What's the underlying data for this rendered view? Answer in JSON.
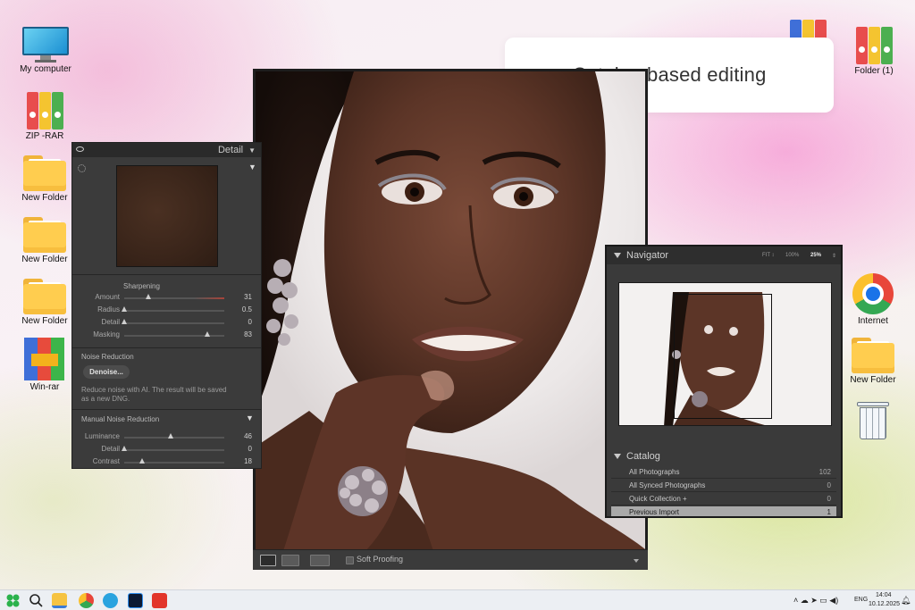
{
  "desktop": {
    "left_icons": [
      {
        "label": "My computer"
      },
      {
        "label": "ZIP -RAR"
      },
      {
        "label": "New Folder"
      },
      {
        "label": "New Folder"
      },
      {
        "label": "New Folder"
      },
      {
        "label": "Win-rar"
      }
    ],
    "right_icons": [
      {
        "label": "Folder (1)"
      },
      {
        "label": "Internet"
      },
      {
        "label": "New Folder"
      }
    ]
  },
  "caption": {
    "text": "Catalog based editing"
  },
  "detail_panel": {
    "title": "Detail",
    "sharpening": {
      "title": "Sharpening",
      "sliders": [
        {
          "label": "Amount",
          "value": "31",
          "level": 0.24
        },
        {
          "label": "Radius",
          "value": "0.5",
          "level": 0.0
        },
        {
          "label": "Detail",
          "value": "0",
          "level": 0.0
        },
        {
          "label": "Masking",
          "value": "83",
          "level": 0.83
        }
      ]
    },
    "noise_reduction": {
      "title": "Noise Reduction",
      "button": "Denoise...",
      "desc_line1": "Reduce noise with AI. The result will be saved",
      "desc_line2": "as a new DNG."
    },
    "manual_noise": {
      "title": "Manual Noise Reduction",
      "sliders": [
        {
          "label": "Luminance",
          "value": "46",
          "level": 0.46
        },
        {
          "label": "Detail",
          "value": "0",
          "level": 0.0
        },
        {
          "label": "Contrast",
          "value": "18",
          "level": 0.18
        }
      ]
    }
  },
  "photo_toolbar": {
    "soft_proofing": "Soft Proofing"
  },
  "navigator": {
    "title": "Navigator",
    "zoom_fit": "FIT ↕",
    "zoom_100": "100%",
    "zoom_25": "25%"
  },
  "catalog": {
    "title": "Catalog",
    "rows": [
      {
        "name": "All Photographs",
        "count": "102"
      },
      {
        "name": "All Synced Photographs",
        "count": "0"
      },
      {
        "name": "Quick Collection  +",
        "count": "0"
      },
      {
        "name": "Previous Import",
        "count": "1"
      }
    ]
  },
  "taskbar": {
    "lang": "ENG",
    "time": "14:04",
    "date": "10.12.2025"
  },
  "colors": {
    "panel_bg": "#3b3b3b",
    "panel_header": "#2a2a2a",
    "selected_row": "#a9a9a9",
    "caption_text": "#333333"
  }
}
